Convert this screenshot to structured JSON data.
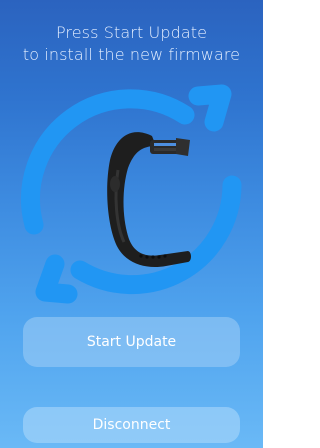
{
  "header": {
    "line1": "Press Start Update",
    "line2": "to install the new firmware"
  },
  "illustration": {
    "icon": "sync-arrows-icon",
    "device": "fitness-band",
    "arrow_color": "#2196f3",
    "band_color": "#222222"
  },
  "actions": {
    "start_label": "Start Update",
    "disconnect_label": "Disconnect"
  }
}
